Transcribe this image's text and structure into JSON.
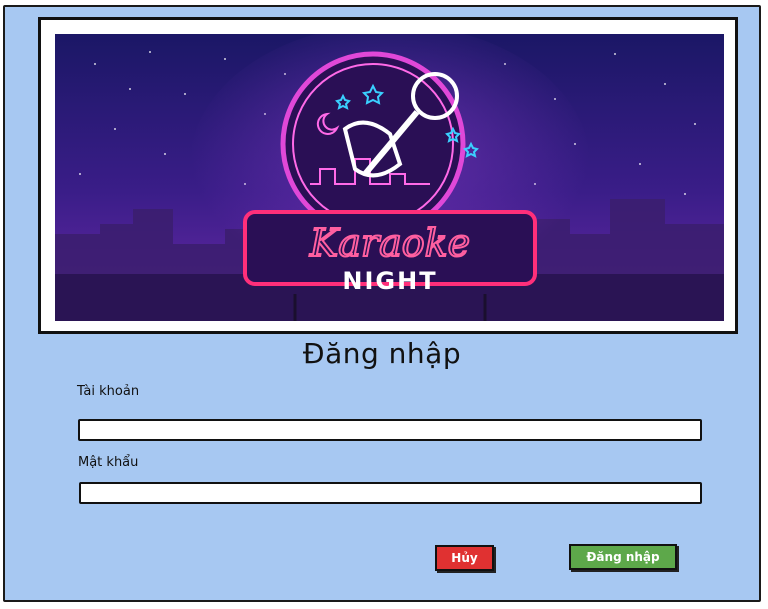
{
  "banner": {
    "sign_script": "Karaoke",
    "sign_subtitle": "NIGHT"
  },
  "form": {
    "title": "Đăng nhập",
    "account_label": "Tài khoản",
    "account_value": "",
    "password_label": "Mật khẩu",
    "password_value": ""
  },
  "buttons": {
    "cancel_label": "Hủy",
    "login_label": "Đăng nhập"
  },
  "colors": {
    "background": "#a7c8f2",
    "cancel": "#e03131",
    "login": "#5da84a"
  }
}
